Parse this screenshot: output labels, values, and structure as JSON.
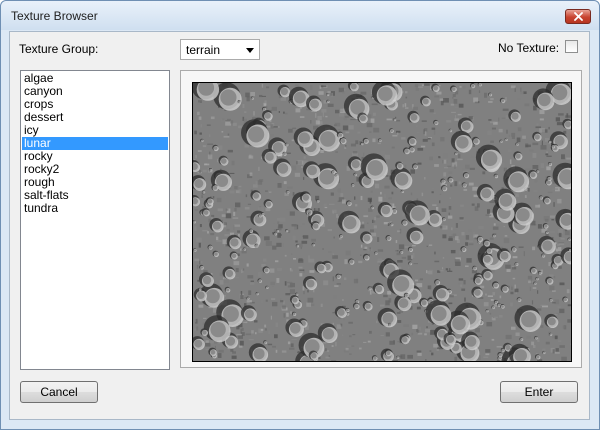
{
  "window": {
    "title": "Texture Browser",
    "close_icon": "close-icon"
  },
  "header": {
    "group_label": "Texture Group:",
    "group_value": "terrain",
    "no_texture_label": "No Texture:",
    "no_texture_checked": false
  },
  "textures": {
    "items": [
      "algae",
      "canyon",
      "crops",
      "dessert",
      "icy",
      "lunar",
      "rocky",
      "rocky2",
      "rough",
      "salt-flats",
      "tundra"
    ],
    "selected": "lunar"
  },
  "buttons": {
    "cancel": "Cancel",
    "enter": "Enter"
  },
  "colors": {
    "selection": "#3399ff",
    "close": "#c8432f"
  }
}
